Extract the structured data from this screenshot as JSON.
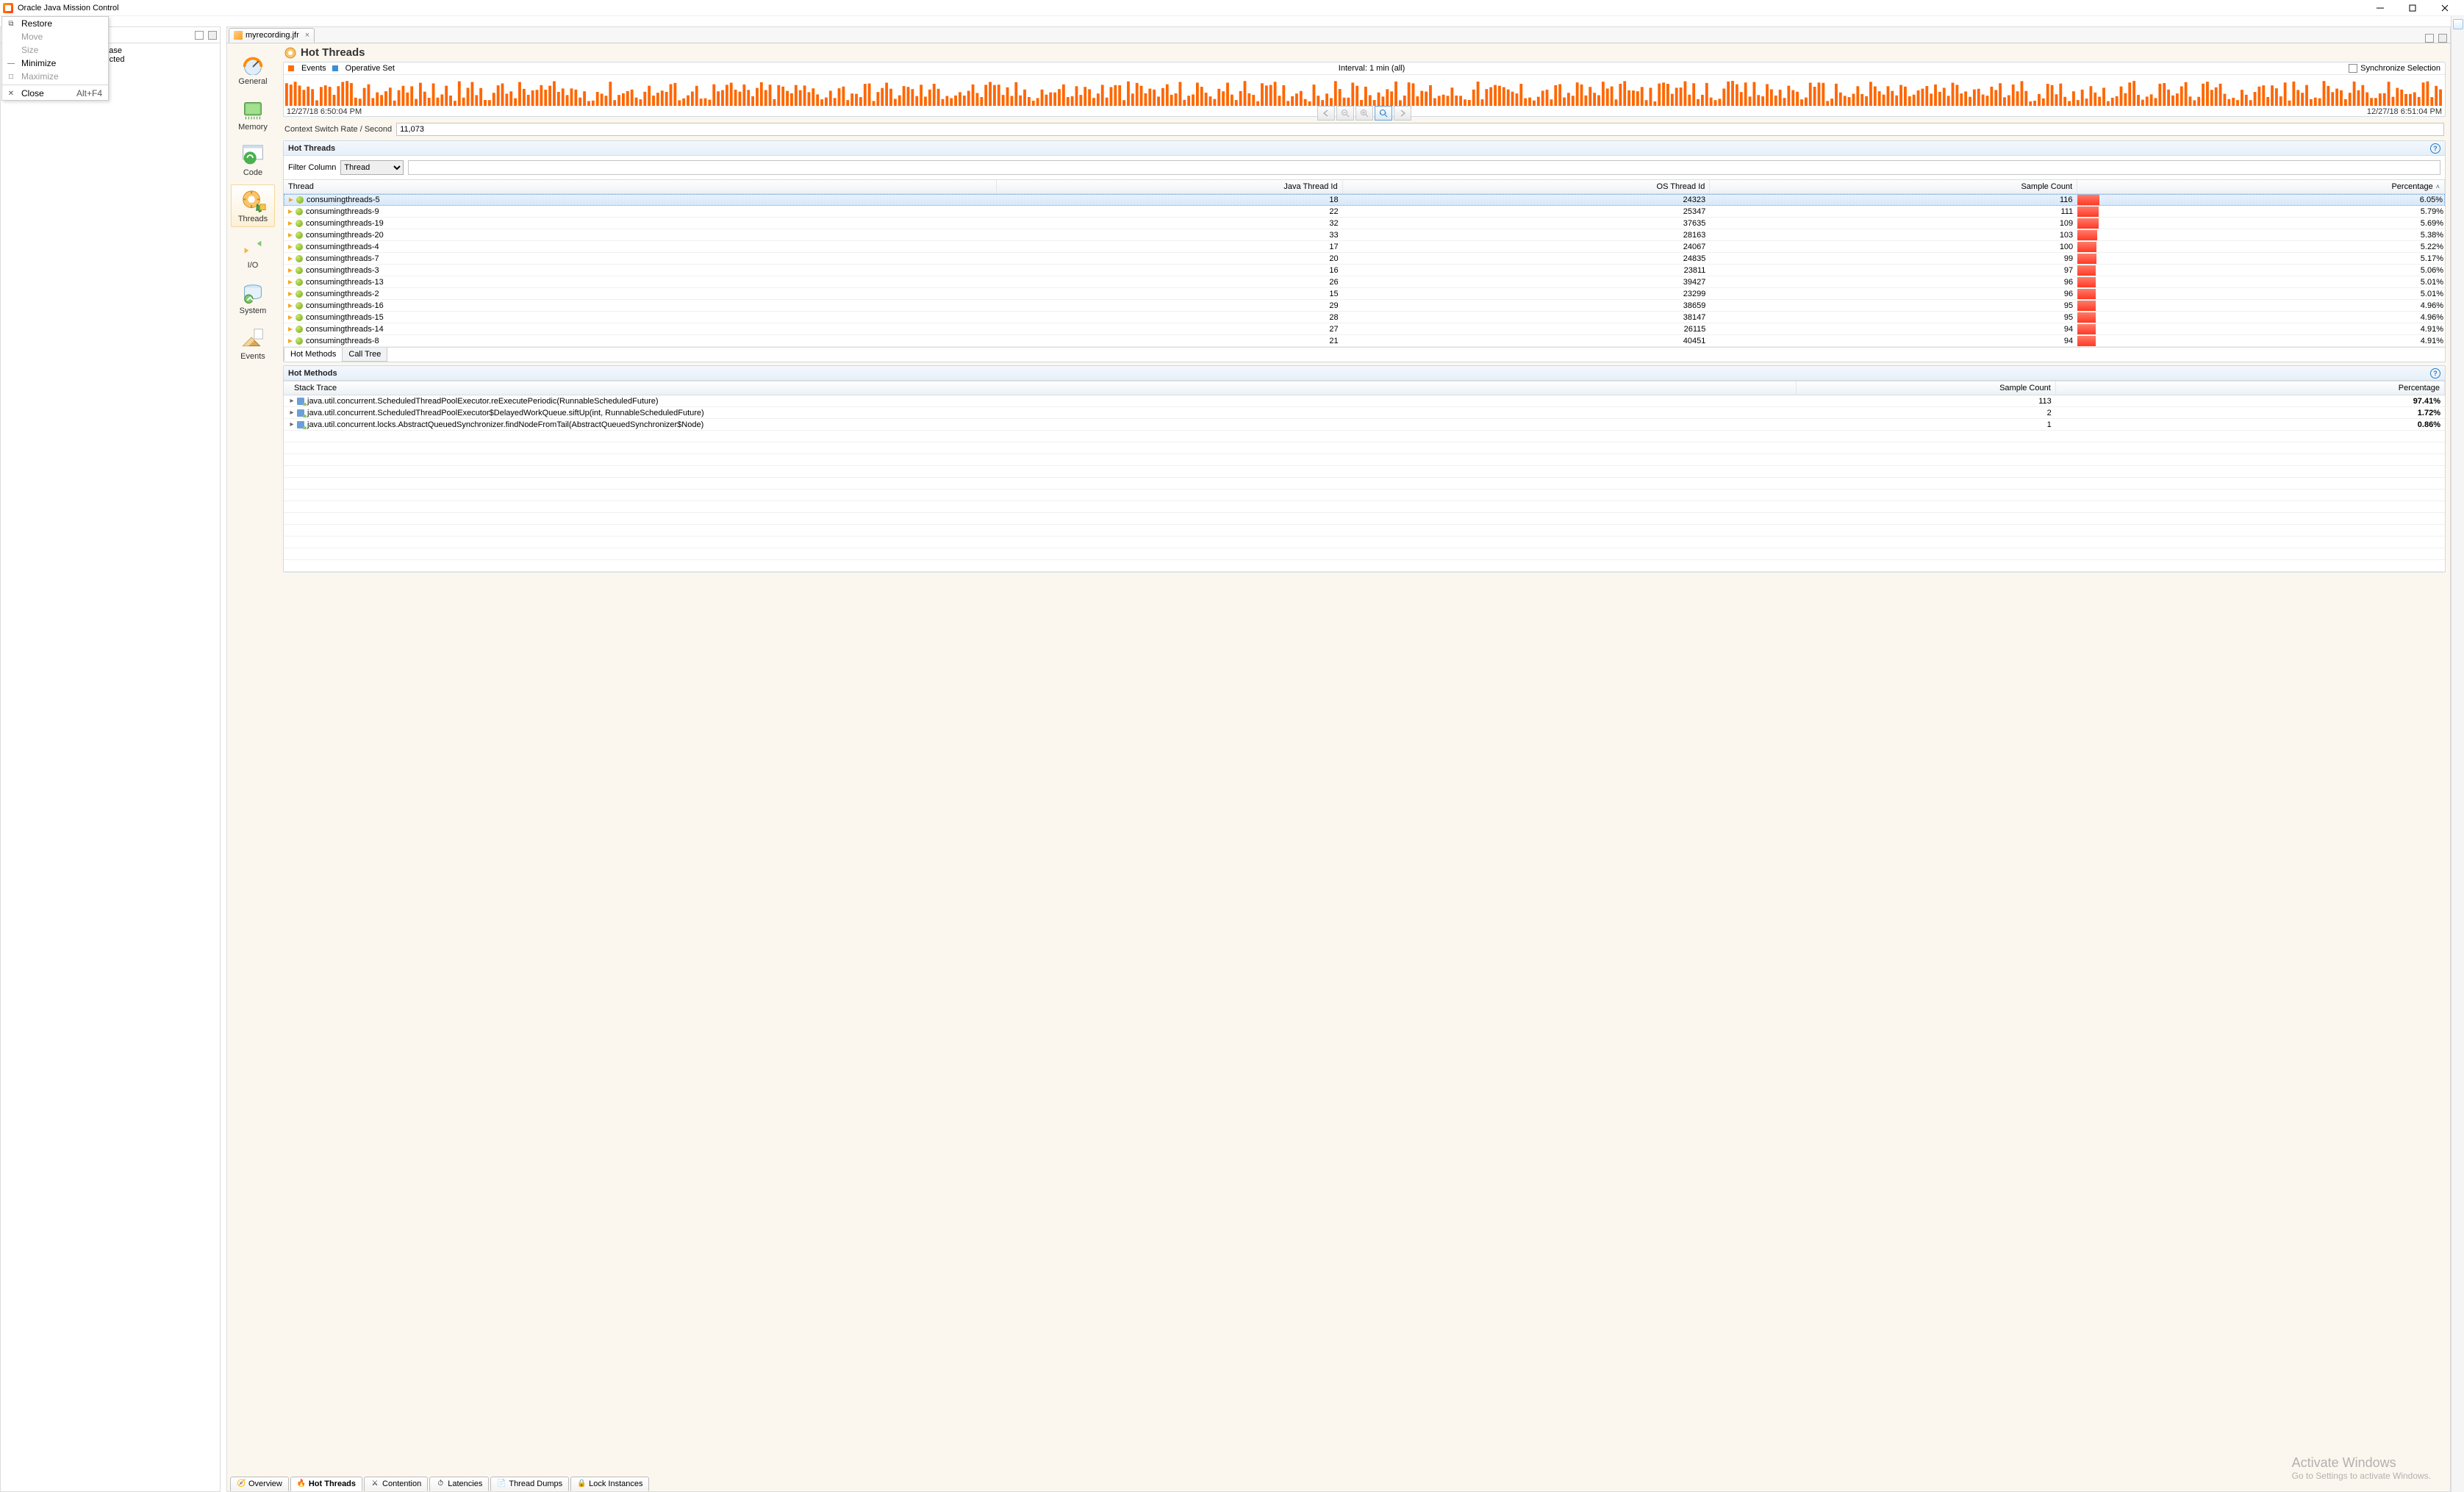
{
  "window": {
    "title": "Oracle Java Mission Control"
  },
  "sysmenu": {
    "restore": "Restore",
    "move": "Move",
    "size": "Size",
    "minimize": "Minimize",
    "maximize": "Maximize",
    "close": "Close",
    "close_shortcut": "Alt+F4"
  },
  "left_hint": {
    "line1": "the Java Flight Recorder. Please",
    "line2": "e the Event Types of the selected",
    "summary_ellipsis": "s"
  },
  "editor_tab": {
    "label": "myrecording.jfr"
  },
  "vnav": [
    {
      "key": "general",
      "label": "General"
    },
    {
      "key": "memory",
      "label": "Memory"
    },
    {
      "key": "code",
      "label": "Code"
    },
    {
      "key": "threads",
      "label": "Threads"
    },
    {
      "key": "io",
      "label": "I/O"
    },
    {
      "key": "system",
      "label": "System"
    },
    {
      "key": "events",
      "label": "Events"
    }
  ],
  "page": {
    "title": "Hot Threads"
  },
  "timeline": {
    "legend_events": "Events",
    "legend_opset": "Operative Set",
    "interval": "Interval: 1 min (all)",
    "sync": "Synchronize Selection",
    "start": "12/27/18 6:50:04 PM",
    "end": "12/27/18 6:51:04 PM"
  },
  "ctx": {
    "label": "Context Switch Rate / Second",
    "value": "11,073"
  },
  "hot_threads": {
    "title": "Hot Threads",
    "filter_label": "Filter Column",
    "filter_select": "Thread",
    "columns": {
      "thread": "Thread",
      "jtid": "Java Thread Id",
      "otid": "OS Thread Id",
      "samples": "Sample Count",
      "pct": "Percentage"
    },
    "rows": [
      {
        "name": "consumingthreads-5",
        "jtid": "18",
        "otid": "24323",
        "samples": "116",
        "pct": "6.05%",
        "bar": 6.05
      },
      {
        "name": "consumingthreads-9",
        "jtid": "22",
        "otid": "25347",
        "samples": "111",
        "pct": "5.79%",
        "bar": 5.79
      },
      {
        "name": "consumingthreads-19",
        "jtid": "32",
        "otid": "37635",
        "samples": "109",
        "pct": "5.69%",
        "bar": 5.69
      },
      {
        "name": "consumingthreads-20",
        "jtid": "33",
        "otid": "28163",
        "samples": "103",
        "pct": "5.38%",
        "bar": 5.38
      },
      {
        "name": "consumingthreads-4",
        "jtid": "17",
        "otid": "24067",
        "samples": "100",
        "pct": "5.22%",
        "bar": 5.22
      },
      {
        "name": "consumingthreads-7",
        "jtid": "20",
        "otid": "24835",
        "samples": "99",
        "pct": "5.17%",
        "bar": 5.17
      },
      {
        "name": "consumingthreads-3",
        "jtid": "16",
        "otid": "23811",
        "samples": "97",
        "pct": "5.06%",
        "bar": 5.06
      },
      {
        "name": "consumingthreads-13",
        "jtid": "26",
        "otid": "39427",
        "samples": "96",
        "pct": "5.01%",
        "bar": 5.01
      },
      {
        "name": "consumingthreads-2",
        "jtid": "15",
        "otid": "23299",
        "samples": "96",
        "pct": "5.01%",
        "bar": 5.01
      },
      {
        "name": "consumingthreads-16",
        "jtid": "29",
        "otid": "38659",
        "samples": "95",
        "pct": "4.96%",
        "bar": 4.96
      },
      {
        "name": "consumingthreads-15",
        "jtid": "28",
        "otid": "38147",
        "samples": "95",
        "pct": "4.96%",
        "bar": 4.96
      },
      {
        "name": "consumingthreads-14",
        "jtid": "27",
        "otid": "26115",
        "samples": "94",
        "pct": "4.91%",
        "bar": 4.91
      },
      {
        "name": "consumingthreads-8",
        "jtid": "21",
        "otid": "40451",
        "samples": "94",
        "pct": "4.91%",
        "bar": 4.91
      }
    ]
  },
  "subtabs": {
    "hot_methods": "Hot Methods",
    "call_tree": "Call Tree"
  },
  "hot_methods": {
    "title": "Hot Methods",
    "columns": {
      "trace": "Stack Trace",
      "samples": "Sample Count",
      "pct": "Percentage"
    },
    "rows": [
      {
        "trace": "java.util.concurrent.ScheduledThreadPoolExecutor.reExecutePeriodic(RunnableScheduledFuture)",
        "samples": "113",
        "pct": "97.41%"
      },
      {
        "trace": "java.util.concurrent.ScheduledThreadPoolExecutor$DelayedWorkQueue.siftUp(int, RunnableScheduledFuture)",
        "samples": "2",
        "pct": "1.72%"
      },
      {
        "trace": "java.util.concurrent.locks.AbstractQueuedSynchronizer.findNodeFromTail(AbstractQueuedSynchronizer$Node)",
        "samples": "1",
        "pct": "0.86%"
      }
    ]
  },
  "bottom_tabs": [
    {
      "label": "Overview"
    },
    {
      "label": "Hot Threads"
    },
    {
      "label": "Contention"
    },
    {
      "label": "Latencies"
    },
    {
      "label": "Thread Dumps"
    },
    {
      "label": "Lock Instances"
    }
  ],
  "watermark": {
    "l1": "Activate Windows",
    "l2": "Go to Settings to activate Windows."
  }
}
